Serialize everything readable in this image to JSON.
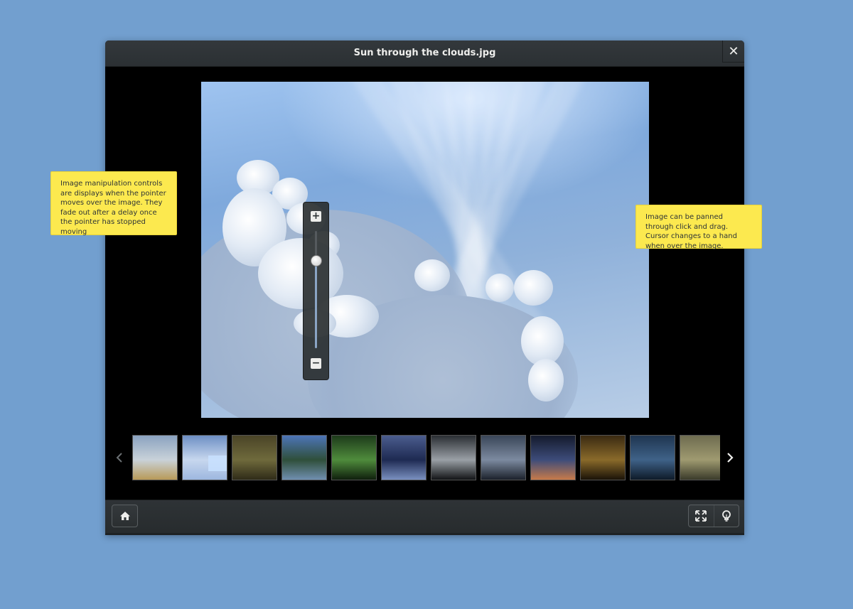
{
  "window": {
    "title": "Sun through the clouds.jpg"
  },
  "titlebar": {
    "close_label": "✕"
  },
  "zoom": {
    "plus_label": "+",
    "minus_label": "−",
    "level": 0.75
  },
  "rotate": {
    "left_icon": "rotate-left-icon",
    "right_icon": "rotate-right-icon"
  },
  "filmstrip": {
    "thumbnails": [
      {
        "name": "thumb-1",
        "colors": [
          "#8aa2c0",
          "#c9d2d9",
          "#b89a58"
        ]
      },
      {
        "name": "thumb-2",
        "colors": [
          "#6d8fc4",
          "#c7d7ee",
          "#9db7df"
        ],
        "selected": true
      },
      {
        "name": "thumb-3",
        "colors": [
          "#4a4427",
          "#6f6a3c",
          "#2f2b18"
        ]
      },
      {
        "name": "thumb-4",
        "colors": [
          "#4d75b8",
          "#2f4f3a",
          "#708fb0"
        ]
      },
      {
        "name": "thumb-5",
        "colors": [
          "#1d3a1a",
          "#4f8c3c",
          "#0f1f0d"
        ]
      },
      {
        "name": "thumb-6",
        "colors": [
          "#4b5d8e",
          "#1e2a52",
          "#7a90c0"
        ]
      },
      {
        "name": "thumb-7",
        "colors": [
          "#2a2e33",
          "#9aa0a6",
          "#121416"
        ]
      },
      {
        "name": "thumb-8",
        "colors": [
          "#3a4658",
          "#7c8aa0",
          "#1b212b"
        ]
      },
      {
        "name": "thumb-9",
        "colors": [
          "#141a2c",
          "#3d4c7a",
          "#c77a4a"
        ]
      },
      {
        "name": "thumb-10",
        "colors": [
          "#3a2a12",
          "#8a6a2a",
          "#1a1208"
        ]
      },
      {
        "name": "thumb-11",
        "colors": [
          "#1f3550",
          "#3f6288",
          "#0e1a28"
        ]
      },
      {
        "name": "thumb-12",
        "colors": [
          "#6e6c50",
          "#9f9a70",
          "#3a3a2a"
        ]
      }
    ]
  },
  "bottombar": {
    "home_icon": "home-icon",
    "fullscreen_icon": "fullscreen-icon",
    "tips_icon": "lightbulb-icon"
  },
  "notes": {
    "controls": "Image manipulation controls are displays when the pointer moves over the image. They fade out after a delay once the pointer has stopped moving",
    "pan": "Image can be panned through click and drag. Cursor changes to a hand when over the image."
  },
  "colors": {
    "desktop": "#729fcf",
    "note_bg": "#fce94f",
    "titlebar": "#2e3336"
  }
}
